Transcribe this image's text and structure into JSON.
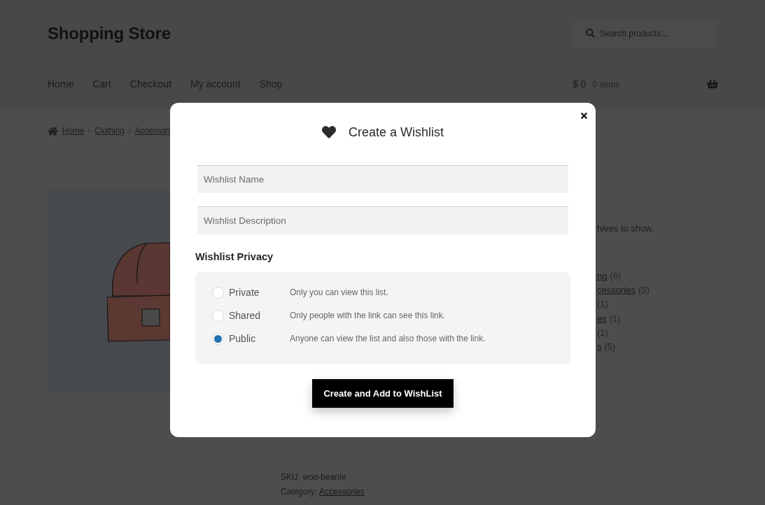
{
  "header": {
    "site_title": "Shopping Store",
    "search": {
      "placeholder": "Search products…"
    },
    "nav": [
      "Home",
      "Cart",
      "Checkout",
      "My account",
      "Shop"
    ],
    "cart": {
      "amount": "$ 0",
      "count": "0 items"
    }
  },
  "breadcrumb": [
    "Home",
    "Clothing",
    "Accessori"
  ],
  "sidebar": {
    "archives_text": "hives to show.",
    "categories": [
      {
        "link": "ng",
        "count": "(6)"
      },
      {
        "link": "cessories",
        "count": "(5)"
      },
      {
        "count": "(1)"
      },
      {
        "link": "es",
        "count": "(1)"
      },
      {
        "count": "(1)"
      },
      {
        "link": "s",
        "count": "(5)"
      }
    ]
  },
  "product_meta": {
    "sku": "SKU: woo-beanie",
    "category_label": "Category:",
    "category_link": "Accessories"
  },
  "modal": {
    "title": "Create a Wishlist",
    "fields": [
      {
        "placeholder": "Wishlist Name"
      },
      {
        "placeholder": "Wishlist Description"
      }
    ],
    "privacy": {
      "label": "Wishlist Privacy",
      "options": [
        {
          "label": "Private",
          "description": "Only you can view this list.",
          "selected": false
        },
        {
          "label": "Shared",
          "description": "Only people with the link can see this link.",
          "selected": false
        },
        {
          "label": "Public",
          "description": "Anyone can view the list and also those with the link.",
          "selected": true
        }
      ]
    },
    "submit": "Create and Add to WishList"
  }
}
